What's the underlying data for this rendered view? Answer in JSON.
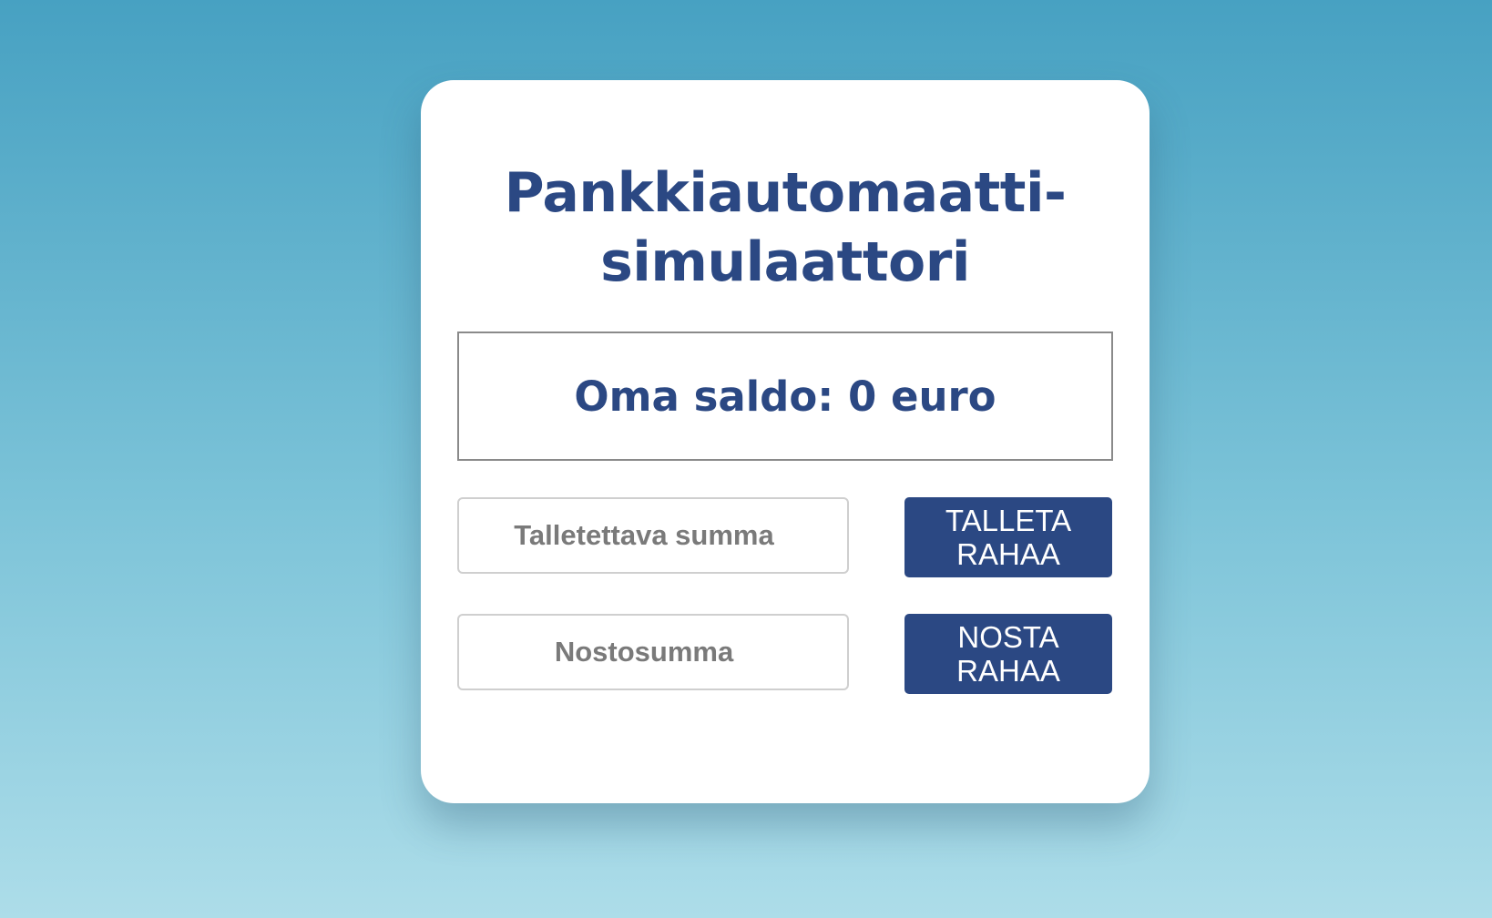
{
  "page": {
    "background_top": "#47a1c2",
    "background_bottom": "#addde9"
  },
  "card": {
    "title_line1": "Pankkiautomaatti-",
    "title_line2": "simulaattori",
    "title_color": "#2b4883"
  },
  "balance": {
    "label": "Oma saldo:",
    "amount": "0",
    "unit": "euro"
  },
  "deposit": {
    "placeholder": "Talletettava summa",
    "value": "",
    "button_label": "TALLETA\nRAHAA"
  },
  "withdraw": {
    "placeholder": "Nostosumma",
    "value": "",
    "button_label": "NOSTA\nRAHAA"
  },
  "colors": {
    "accent": "#2b4883",
    "card_background": "#ffffff",
    "input_border": "#cfcfcf",
    "balance_border": "#8a8a8a"
  }
}
